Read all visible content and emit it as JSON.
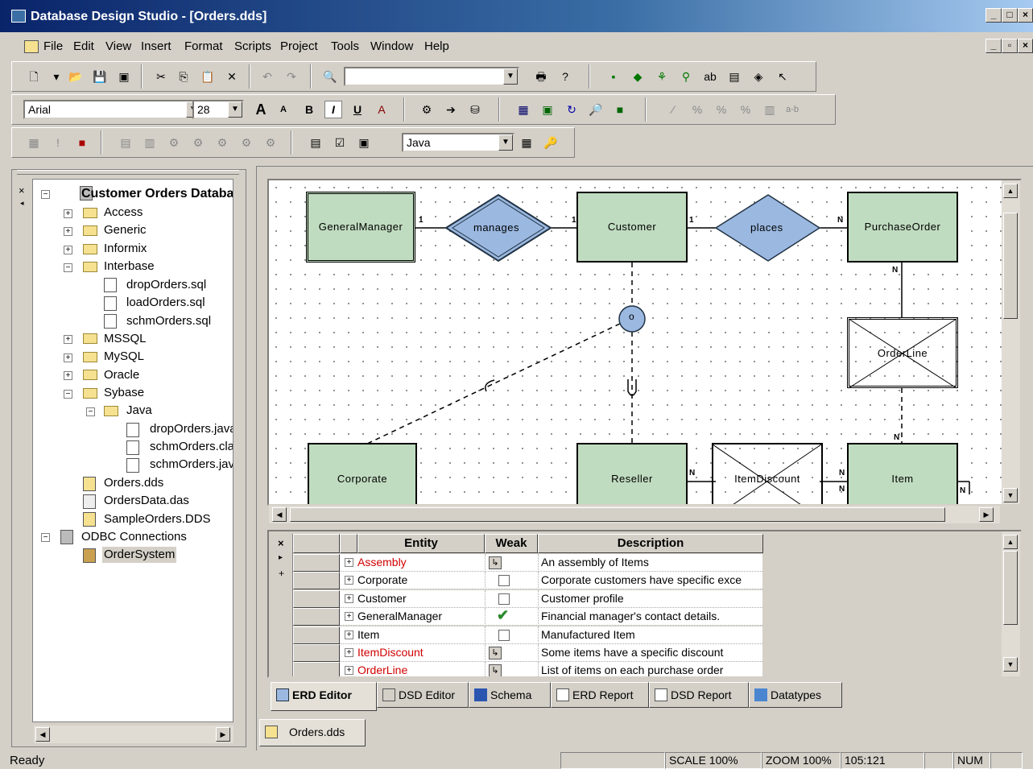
{
  "window": {
    "title": "Database Design Studio - [Orders.dds]"
  },
  "menu": [
    "File",
    "Edit",
    "View",
    "Insert",
    "Format",
    "Scripts",
    "Project",
    "Tools",
    "Window",
    "Help"
  ],
  "toolbar": {
    "font_name": "Arial",
    "font_size": "28",
    "language": "Java",
    "find_value": ""
  },
  "tree": {
    "root": "Customer Orders Databa",
    "items": [
      "Access",
      "Generic",
      "Informix",
      "Interbase",
      "dropOrders.sql",
      "loadOrders.sql",
      "schmOrders.sql",
      "MSSQL",
      "MySQL",
      "Oracle",
      "Sybase",
      "Java",
      "dropOrders.java",
      "schmOrders.cla",
      "schmOrders.jav",
      "Orders.dds",
      "OrdersData.das",
      "SampleOrders.DDS",
      "ODBC Connections",
      "OrderSystem"
    ]
  },
  "erd": {
    "entities": [
      "GeneralManager",
      "Customer",
      "PurchaseOrder",
      "OrderLine",
      "Corporate",
      "Reseller",
      "ItemDiscount",
      "Item"
    ],
    "relationships": [
      "manages",
      "places"
    ],
    "labels": {
      "one": "1",
      "many": "N",
      "disjoint": "o",
      "many_bold": "N"
    }
  },
  "grid": {
    "headers": [
      "Entity",
      "Weak",
      "Description"
    ],
    "rows": [
      {
        "entity": "Assembly",
        "weak": "↳",
        "desc": "An assembly of Items",
        "red": true
      },
      {
        "entity": "Corporate",
        "weak": "",
        "desc": "Corporate customers have specific exce",
        "red": false
      },
      {
        "entity": "Customer",
        "weak": "",
        "desc": "Customer profile",
        "red": false
      },
      {
        "entity": "GeneralManager",
        "weak": "✔",
        "desc": "Financial manager's contact details.",
        "red": false
      },
      {
        "entity": "Item",
        "weak": "",
        "desc": "Manufactured Item",
        "red": false
      },
      {
        "entity": "ItemDiscount",
        "weak": "↳",
        "desc": "Some items have a specific discount",
        "red": true
      },
      {
        "entity": "OrderLine",
        "weak": "↳",
        "desc": "List of items on each purchase order",
        "red": true
      }
    ],
    "row_markers": [
      "×",
      "▸",
      "+"
    ]
  },
  "editor_tabs": [
    "ERD Editor",
    "DSD Editor",
    "Schema",
    "ERD Report",
    "DSD Report",
    "Datatypes"
  ],
  "doc_tab": "Orders.dds",
  "status": {
    "text": "Ready",
    "scale": "SCALE 100%",
    "zoom": "ZOOM 100%",
    "pos": "105:121",
    "num": "NUM"
  }
}
